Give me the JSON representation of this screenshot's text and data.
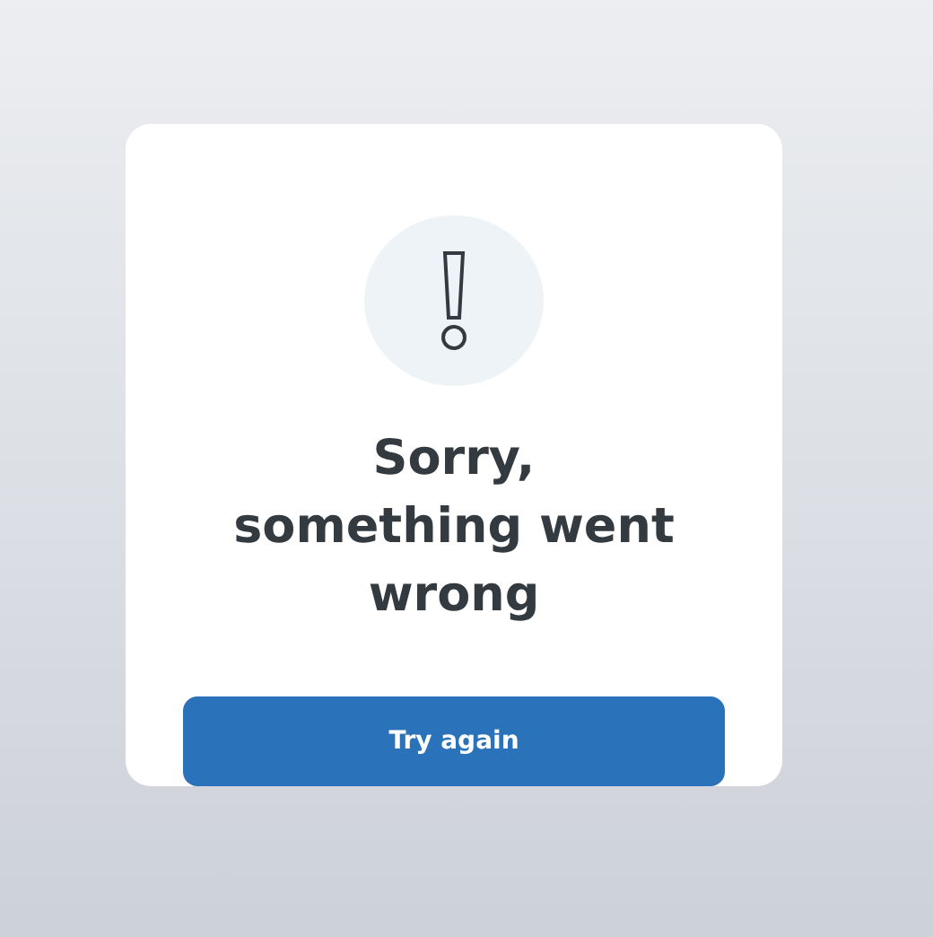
{
  "error_card": {
    "title": "Sorry, something went wrong",
    "button": "Try again"
  }
}
